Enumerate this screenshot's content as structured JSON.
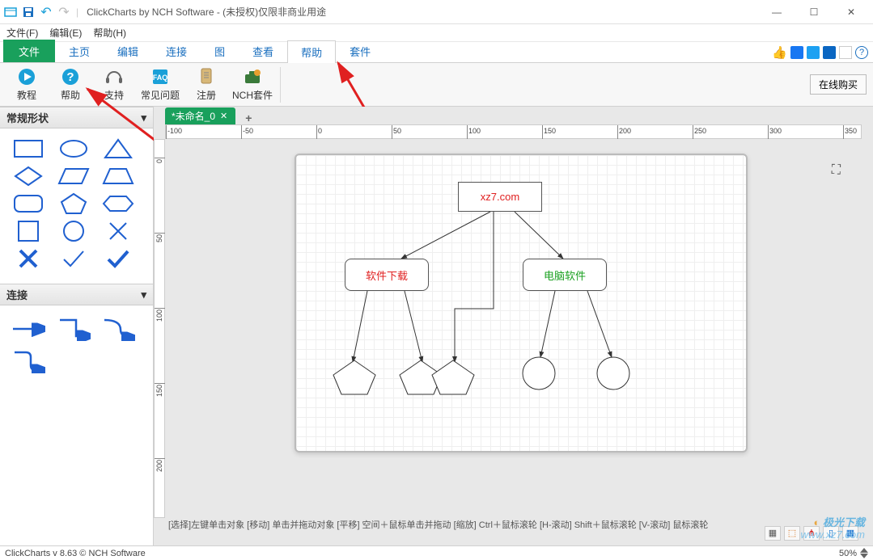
{
  "title": "ClickCharts by NCH Software - (未授权)仅限非商业用途",
  "menu": {
    "file": "文件(F)",
    "edit": "编辑(E)",
    "help": "帮助(H)"
  },
  "tabs": {
    "file": "文件",
    "home": "主页",
    "edit": "编辑",
    "connect": "连接",
    "diagram": "图",
    "view": "查看",
    "help": "帮助",
    "suite": "套件"
  },
  "ribbon": {
    "tutorial": "教程",
    "help": "帮助",
    "support": "支持",
    "faq": "常见问题",
    "register": "注册",
    "nch": "NCH套件",
    "buy": "在线购买"
  },
  "sidebar": {
    "shapes_header": "常规形状",
    "connect_header": "连接"
  },
  "doc": {
    "tabname": "*未命名_0"
  },
  "hruler": [
    -100,
    -50,
    0,
    50,
    100,
    150,
    200,
    250,
    300,
    350
  ],
  "vruler": [
    0,
    50,
    100,
    150,
    200
  ],
  "nodes": {
    "root": "xz7.com",
    "left": "软件下载",
    "right": "电脑软件"
  },
  "hints": "[选择]左键单击对象 [移动] 单击并拖动对象 [平移] 空间＋鼠标单击并拖动 [缩放] Ctrl＋鼠标滚轮 [H-滚动] Shift＋鼠标滚轮 [V-滚动] 鼠标滚轮",
  "status": {
    "version": "ClickCharts v 8.63 © NCH Software",
    "zoom": "50%"
  },
  "watermark": {
    "name": "极光下载",
    "url": "www.xz7.com"
  }
}
